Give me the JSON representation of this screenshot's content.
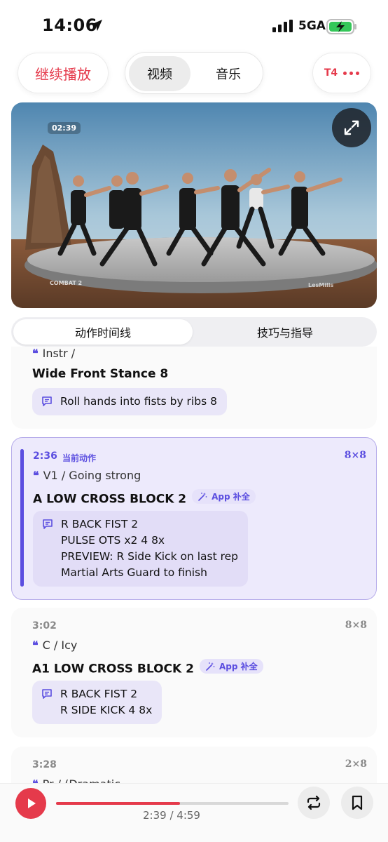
{
  "status_bar": {
    "time": "14:06",
    "network": "5GA"
  },
  "header": {
    "continue_label": "继续播放",
    "segments": [
      "视频",
      "音乐"
    ],
    "selected_segment": "视频",
    "badge_label": "T4"
  },
  "video": {
    "timestamp": "02:39",
    "program_label": "COMBAT 2",
    "brand_label": "LesMills"
  },
  "tabs": [
    "动作时间线",
    "技巧与指导"
  ],
  "selected_tab": "动作时间线",
  "timeline": {
    "current_tag": "当前动作",
    "app_badge": "App 补全",
    "items": [
      {
        "quote": "Instr /",
        "move": "Wide Front Stance 8",
        "notes": [
          "Roll hands into fists by ribs 8"
        ]
      },
      {
        "time": "2:36",
        "count": "8×8",
        "quote": "V1 / Going strong",
        "move": "A LOW CROSS BLOCK 2",
        "notes": [
          "R BACK FIST 2",
          "PULSE OTS x2 4 8x",
          "PREVIEW: R Side Kick on last rep",
          "Martial Arts Guard to finish"
        ]
      },
      {
        "time": "3:02",
        "count": "8×8",
        "quote": "C / Icy",
        "move": "A1 LOW CROSS BLOCK 2",
        "notes": [
          "R BACK FIST 2",
          "R SIDE KICK 4 8x"
        ]
      },
      {
        "time": "3:28",
        "count": "2×8",
        "quote": "Pr / (Dramatic"
      }
    ]
  },
  "player": {
    "progress_text": "2:39 / 4:59",
    "progress_fraction": 0.532
  },
  "colors": {
    "accent_red": "#e53a4b",
    "accent_purple": "#5b4ee0"
  }
}
